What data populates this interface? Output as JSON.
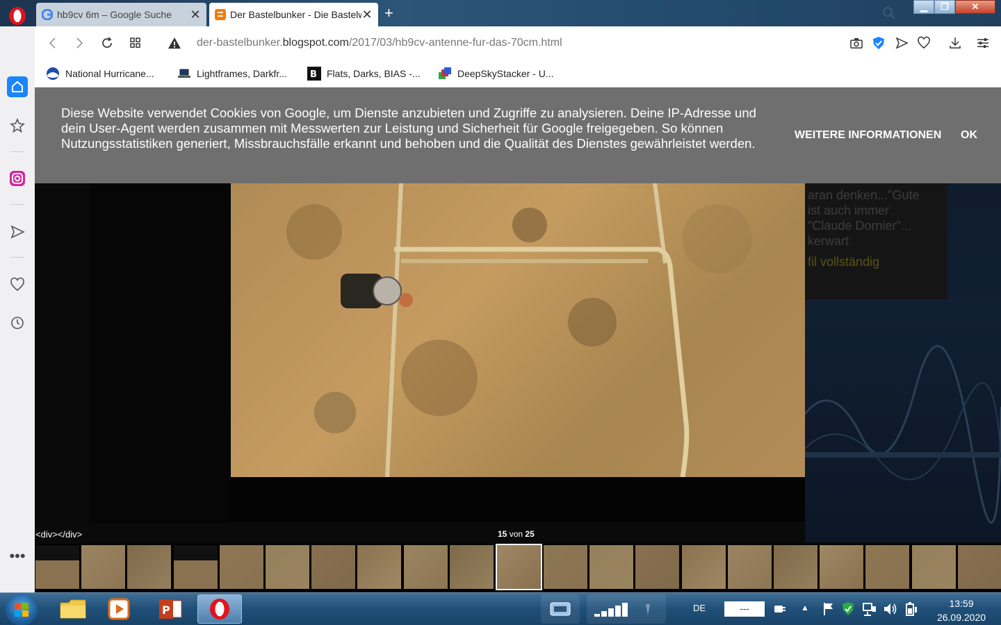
{
  "tabs": [
    {
      "title": "hb9cv 6m – Google Suche",
      "active": false
    },
    {
      "title": "Der Bastelbunker - Die Bastelwerkstatt",
      "active": true
    }
  ],
  "address": {
    "prefix": "der-bastelbunker.",
    "domain": "blogspot.com",
    "path": "/2017/03/hb9cv-antenne-fur-das-70cm.html"
  },
  "bookmarks": [
    {
      "label": "National Hurricane...",
      "icon": "noaa-icon"
    },
    {
      "label": "Lightframes, Darkfr...",
      "icon": "laptop-icon"
    },
    {
      "label": "Flats, Darks, BIAS -...",
      "icon": "b-logo-icon"
    },
    {
      "label": "DeepSkyStacker - U...",
      "icon": "deepskystacker-icon"
    }
  ],
  "cookie_banner": {
    "message": "Diese Website verwendet Cookies von Google, um Dienste anzubieten und Zugriffe zu analysieren. Deine IP-Adresse und dein User-Agent werden zusammen mit Messwerten zur Leistung und Sicherheit für Google freigegeben. So können Nutzungsstatistiken generiert, Missbrauchsfälle erkannt und behoben und die Qualität des Dienstes gewährleistet werden.",
    "more_label": "WEITERE INFORMATIONEN",
    "ok_label": "OK"
  },
  "side_snippet": {
    "line1": "aran denken...\"Gute",
    "line2": "ist auch immer",
    "line3": "\"Claude Dornier\"...",
    "line4": "kerwart",
    "link": "fil vollständig"
  },
  "lightbox": {
    "div_text": "<div></div>",
    "current": "15",
    "of": "von",
    "total": "25",
    "thumb_count": 21,
    "active_index": 10
  },
  "taskbar": {
    "lang": "DE",
    "volume_box": "---",
    "time": "13:59",
    "date": "26.09.2020"
  },
  "colors": {
    "opera_red": "#e0131f",
    "speed_dial_blue": "#1a85ff",
    "cookie_bg": "#6f6f6f"
  }
}
